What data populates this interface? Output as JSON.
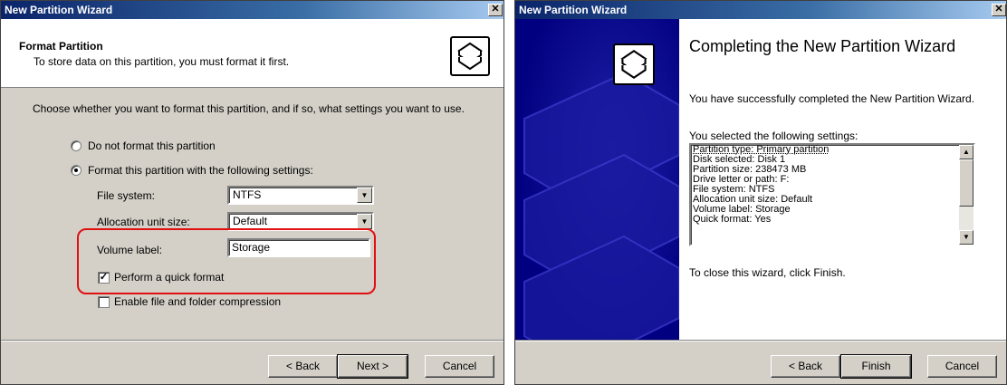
{
  "format_window": {
    "title": "New Partition Wizard",
    "close_glyph": "✕",
    "header_title": "Format Partition",
    "header_subtitle": "To store data on this partition, you must format it first.",
    "instruction": "Choose whether you want to format this partition, and if so, what settings you want to use.",
    "option_no_format": {
      "label": "Do not format this partition",
      "selected": false
    },
    "option_format": {
      "label": "Format this partition with the following settings:",
      "selected": true
    },
    "file_system": {
      "label": "File system:",
      "value": "NTFS"
    },
    "allocation_unit": {
      "label": "Allocation unit size:",
      "value": "Default"
    },
    "volume_label": {
      "label": "Volume label:",
      "value": "Storage"
    },
    "quick_format": {
      "label": "Perform a quick format",
      "checked": true,
      "check_glyph": "✓"
    },
    "compression": {
      "label": "Enable file and folder compression",
      "checked": false
    },
    "buttons": {
      "back": "< Back",
      "next": "Next >",
      "cancel": "Cancel"
    },
    "highlight_color": "#e01010"
  },
  "complete_window": {
    "title": "New Partition Wizard",
    "close_glyph": "✕",
    "heading": "Completing the New Partition Wizard",
    "success_text": "You have successfully completed the New Partition Wizard.",
    "settings_label": "You selected the following settings:",
    "settings": [
      "Partition type: Primary partition",
      "Disk selected: Disk 1",
      "Partition size: 238473 MB",
      "Drive letter or path: F:",
      "File system: NTFS",
      "Allocation unit size: Default",
      "Volume label: Storage",
      "Quick format: Yes"
    ],
    "close_text": "To close this wizard, click Finish.",
    "buttons": {
      "back": "< Back",
      "finish": "Finish",
      "cancel": "Cancel"
    }
  },
  "colors": {
    "window_bg": "#d4d0c8",
    "titlebar": "#0a246a",
    "side_panel": "#000080"
  },
  "icons": {
    "wizard_icon": "disk-stack-icon",
    "dropdown_arrow": "▼",
    "scroll_up": "▲",
    "scroll_down": "▼"
  }
}
